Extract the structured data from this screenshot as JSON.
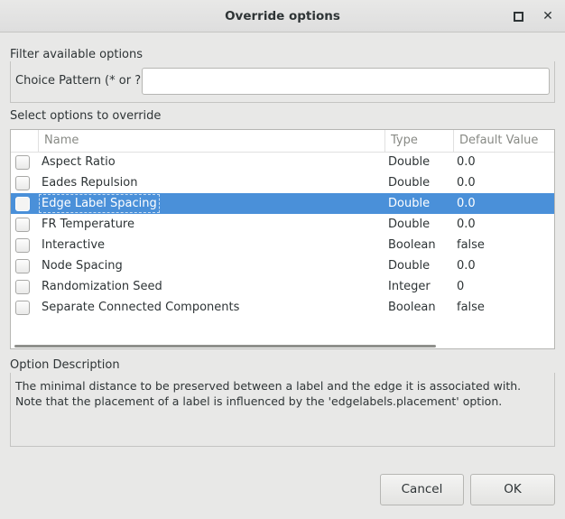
{
  "window": {
    "title": "Override options"
  },
  "filter": {
    "group_label": "Filter available options",
    "pattern_label": "Choice Pattern (* or ?)",
    "pattern_value": ""
  },
  "options": {
    "group_label": "Select options to override",
    "columns": [
      "Name",
      "Type",
      "Default Value"
    ],
    "rows": [
      {
        "name": "Aspect Ratio",
        "type": "Double",
        "default": "0.0",
        "checked": false,
        "selected": false
      },
      {
        "name": "Eades Repulsion",
        "type": "Double",
        "default": "0.0",
        "checked": false,
        "selected": false
      },
      {
        "name": "Edge Label Spacing",
        "type": "Double",
        "default": "0.0",
        "checked": false,
        "selected": true
      },
      {
        "name": "FR Temperature",
        "type": "Double",
        "default": "0.0",
        "checked": false,
        "selected": false
      },
      {
        "name": "Interactive",
        "type": "Boolean",
        "default": "false",
        "checked": false,
        "selected": false
      },
      {
        "name": "Node Spacing",
        "type": "Double",
        "default": "0.0",
        "checked": false,
        "selected": false
      },
      {
        "name": "Randomization Seed",
        "type": "Integer",
        "default": "0",
        "checked": false,
        "selected": false
      },
      {
        "name": "Separate Connected Components",
        "type": "Boolean",
        "default": "false",
        "checked": false,
        "selected": false
      }
    ]
  },
  "description": {
    "group_label": "Option Description",
    "text": "The minimal distance to be preserved between a label and the edge it is associated with. Note that the placement of a label is influenced by the 'edgelabels.placement' option."
  },
  "buttons": {
    "cancel": "Cancel",
    "ok": "OK"
  },
  "colors": {
    "selection": "#4a90d9",
    "background": "#e8e8e7"
  }
}
